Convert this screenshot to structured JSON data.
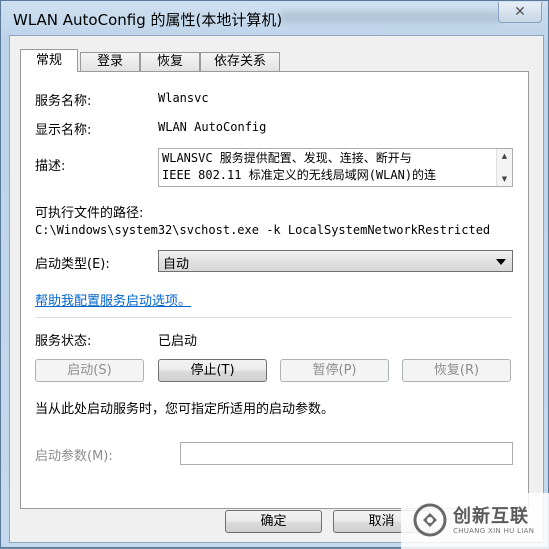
{
  "window": {
    "title": "WLAN AutoConfig 的属性(本地计算机)",
    "close_icon": "✕"
  },
  "tabs": [
    {
      "label": "常规",
      "active": true
    },
    {
      "label": "登录",
      "active": false
    },
    {
      "label": "恢复",
      "active": false
    },
    {
      "label": "依存关系",
      "active": false
    }
  ],
  "general": {
    "service_name_label": "服务名称:",
    "service_name_value": "Wlansvc",
    "display_name_label": "显示名称:",
    "display_name_value": "WLAN AutoConfig",
    "description_label": "描述:",
    "description_value": "WLANSVC 服务提供配置、发现、连接、断开与\nIEEE 802.11 标准定义的无线局域网(WLAN)的连",
    "exe_path_label": "可执行文件的路径:",
    "exe_path_value": "C:\\Windows\\system32\\svchost.exe -k LocalSystemNetworkRestricted",
    "startup_type_label": "启动类型(E):",
    "startup_type_value": "自动",
    "help_link": "帮助我配置服务启动选项。",
    "service_status_label": "服务状态:",
    "service_status_value": "已启动",
    "start_button": "启动(S)",
    "stop_button": "停止(T)",
    "pause_button": "暂停(P)",
    "resume_button": "恢复(R)",
    "start_params_hint": "当从此处启动服务时，您可指定所适用的启动参数。",
    "start_params_label": "启动参数(M):",
    "start_params_value": ""
  },
  "dialog": {
    "ok_button": "确定",
    "cancel_button": "取消"
  },
  "watermark": {
    "text": "创新互联",
    "sub": "CHUANG XIN HU LIAN"
  },
  "colors": {
    "link": "#0066cc",
    "disabled_text": "#8d8d8d"
  }
}
